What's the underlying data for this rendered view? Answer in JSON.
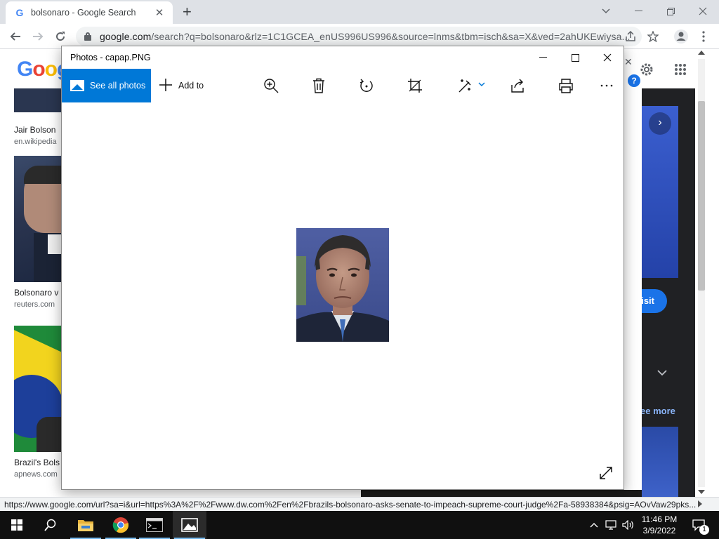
{
  "browser": {
    "tab_title": "bolsonaro - Google Search",
    "url_host": "google.com",
    "url_rest": "/search?q=bolsonaro&rlz=1C1GCEA_enUS996US996&source=lnms&tbm=isch&sa=X&ved=2ahUKEwiysa...",
    "status_url": "https://www.google.com/url?sa=i&url=https%3A%2F%2Fwww.dw.com%2Fen%2Fbrazils-bolsonaro-asks-senate-to-impeach-supreme-court-judge%2Fa-58938384&psig=AOvVaw29pks..."
  },
  "google": {
    "logo": "Goog",
    "results": [
      {
        "title": "Jair Bolson",
        "source": "en.wikipedia"
      },
      {
        "title": "Bolsonaro v",
        "source": "reuters.com"
      },
      {
        "title": "Brazil's Bols",
        "source": "apnews.com"
      }
    ],
    "visit_label": "isit",
    "see_more_label": "ee more"
  },
  "photos": {
    "window_title": "Photos - capap.PNG",
    "see_all_label": "See all photos",
    "add_to_label": "Add to"
  },
  "taskbar": {
    "time": "11:46 PM",
    "date": "3/9/2022",
    "notification_count": "1"
  }
}
